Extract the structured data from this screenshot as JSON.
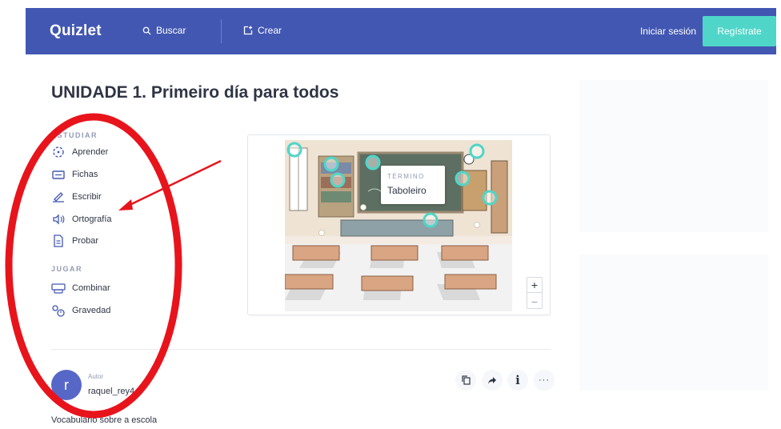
{
  "header": {
    "logo": "Quizlet",
    "search_label": "Buscar",
    "create_label": "Crear",
    "login_label": "Iniciar sesión",
    "signup_label": "Regístrate",
    "brand_color": "#4257b2",
    "signup_color": "#4fd6c8"
  },
  "set": {
    "title": "UNIDADE 1. Primeiro día para todos",
    "description": "Vocabulario sobre a escola"
  },
  "sidebar": {
    "study_label": "ESTUDIAR",
    "play_label": "JUGAR",
    "study_modes": [
      {
        "label": "Aprender",
        "icon": "learn-icon"
      },
      {
        "label": "Fichas",
        "icon": "flashcards-icon"
      },
      {
        "label": "Escribir",
        "icon": "write-icon"
      },
      {
        "label": "Ortografía",
        "icon": "spell-icon"
      },
      {
        "label": "Probar",
        "icon": "test-icon"
      }
    ],
    "play_modes": [
      {
        "label": "Combinar",
        "icon": "match-icon"
      },
      {
        "label": "Gravedad",
        "icon": "gravity-icon"
      }
    ]
  },
  "diagram": {
    "term_label": "TÉRMINO",
    "term_value": "Taboleiro",
    "zoom_in": "+",
    "zoom_out": "−"
  },
  "author": {
    "label": "Autor",
    "name": "raquel_rey4",
    "avatar_letter": "r"
  },
  "actions": {
    "more": "···",
    "info": "i"
  },
  "annotation_color": "#e8141c"
}
